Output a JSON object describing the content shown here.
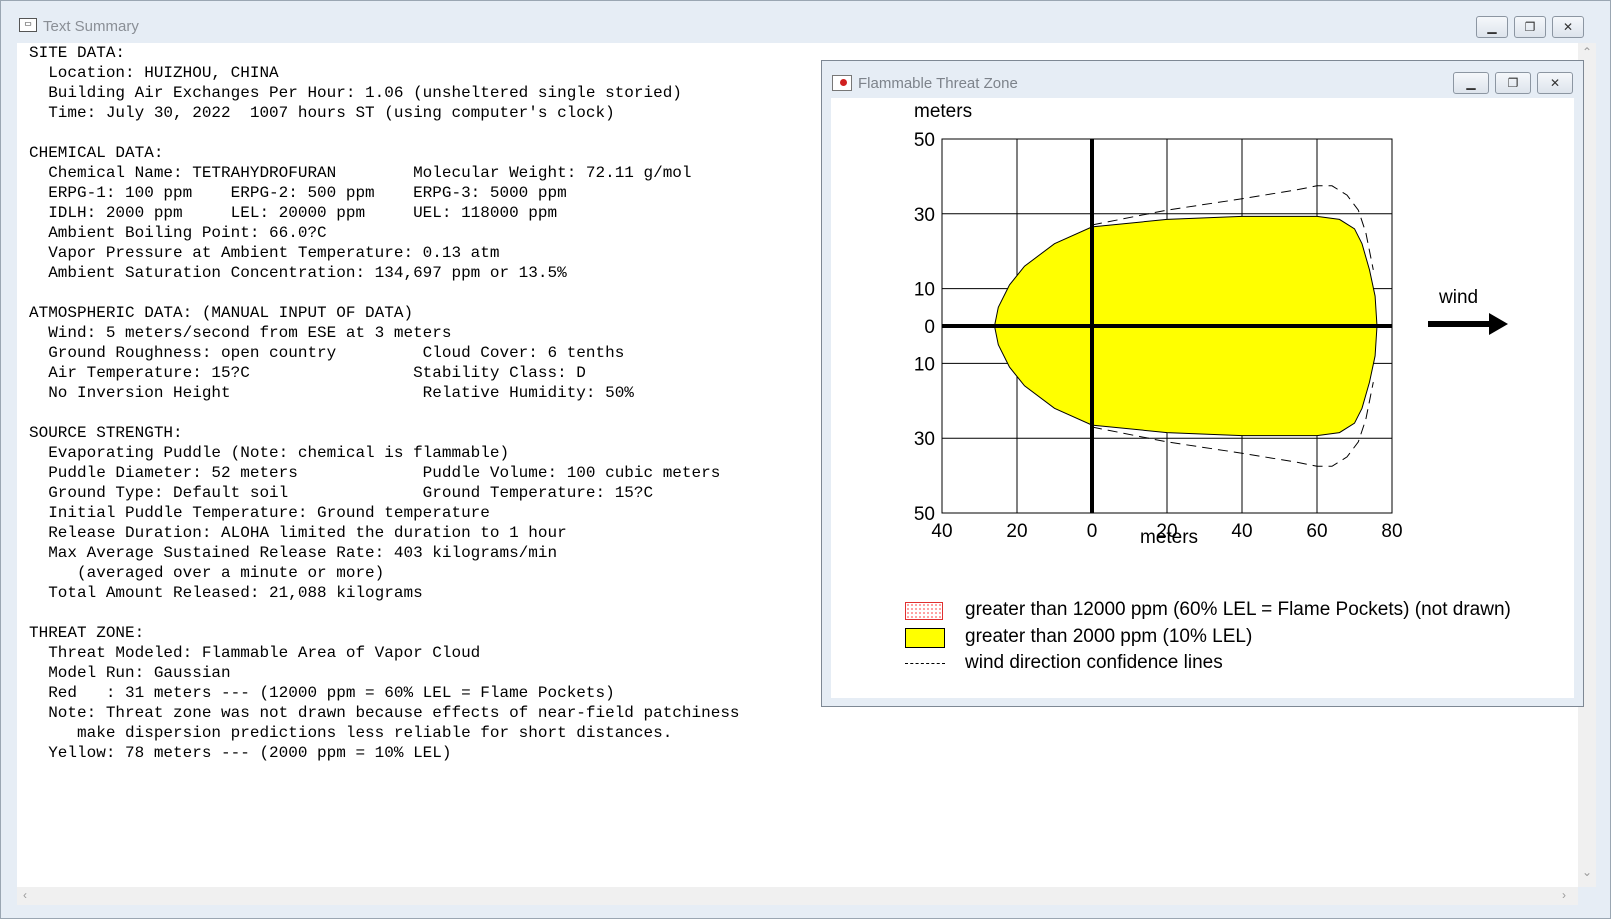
{
  "window": {
    "title": "Text Summary",
    "icon": "app-icon",
    "buttons": {
      "minimize": "minimize-icon",
      "maximize": "maximize-icon",
      "close": "close-icon"
    }
  },
  "summary_lines": [
    "SITE DATA:",
    "  Location: HUIZHOU, CHINA",
    "  Building Air Exchanges Per Hour: 1.06 (unsheltered single storied)",
    "  Time: July 30, 2022  1007 hours ST (using computer's clock)",
    "",
    "CHEMICAL DATA:",
    "  Chemical Name: TETRAHYDROFURAN        Molecular Weight: 72.11 g/mol",
    "  ERPG-1: 100 ppm    ERPG-2: 500 ppm    ERPG-3: 5000 ppm",
    "  IDLH: 2000 ppm     LEL: 20000 ppm     UEL: 118000 ppm",
    "  Ambient Boiling Point: 66.0?C",
    "  Vapor Pressure at Ambient Temperature: 0.13 atm",
    "  Ambient Saturation Concentration: 134,697 ppm or 13.5%",
    "",
    "ATMOSPHERIC DATA: (MANUAL INPUT OF DATA)",
    "  Wind: 5 meters/second from ESE at 3 meters",
    "  Ground Roughness: open country         Cloud Cover: 6 tenths",
    "  Air Temperature: 15?C                 Stability Class: D",
    "  No Inversion Height                    Relative Humidity: 50%",
    "",
    "SOURCE STRENGTH:",
    "  Evaporating Puddle (Note: chemical is flammable)",
    "  Puddle Diameter: 52 meters             Puddle Volume: 100 cubic meters",
    "  Ground Type: Default soil              Ground Temperature: 15?C",
    "  Initial Puddle Temperature: Ground temperature",
    "  Release Duration: ALOHA limited the duration to 1 hour",
    "  Max Average Sustained Release Rate: 403 kilograms/min",
    "     (averaged over a minute or more)",
    "  Total Amount Released: 21,088 kilograms",
    "",
    "THREAT ZONE:",
    "  Threat Modeled: Flammable Area of Vapor Cloud",
    "  Model Run: Gaussian",
    "  Red   : 31 meters --- (12000 ppm = 60% LEL = Flame Pockets)",
    "  Note: Threat zone was not drawn because effects of near-field patchiness",
    "     make dispersion predictions less reliable for short distances.",
    "  Yellow: 78 meters --- (2000 ppm = 10% LEL)"
  ],
  "threat_window": {
    "title": "Flammable Threat Zone",
    "icon": "chart-icon",
    "buttons": {
      "minimize": "minimize-icon",
      "maximize": "maximize-icon",
      "close": "close-icon"
    },
    "wind_label": "wind",
    "legend": [
      {
        "swatch": "red-dotted",
        "label": "greater than 12000 ppm (60% LEL = Flame Pockets) (not drawn)"
      },
      {
        "swatch": "yellow",
        "label": "greater than 2000 ppm (10% LEL)"
      },
      {
        "swatch": "dashed-line",
        "label": "wind direction confidence lines"
      }
    ]
  },
  "chart_data": {
    "type": "area",
    "xlabel": "meters",
    "ylabel": "meters",
    "xlim": [
      -40,
      80
    ],
    "ylim": [
      -50,
      50
    ],
    "x_ticks": [
      -40,
      -20,
      0,
      20,
      40,
      60,
      80
    ],
    "x_tick_labels": [
      "40",
      "20",
      "0",
      "20",
      "40",
      "60",
      "80"
    ],
    "y_ticks": [
      50,
      30,
      10,
      0,
      -10,
      -30,
      -50
    ],
    "y_tick_labels": [
      "50",
      "30",
      "10",
      "0",
      "10",
      "30",
      "50"
    ],
    "grid": true,
    "colors": {
      "zone": "#ffff00",
      "axes": "#000000"
    },
    "yellow_zone": {
      "x": [
        0,
        20,
        40,
        60,
        66,
        70,
        72,
        74,
        75.5,
        76,
        75.5,
        74,
        72,
        70,
        66,
        60,
        40,
        20,
        0,
        -10,
        -18,
        -22,
        -25,
        -26,
        -25,
        -22,
        -18,
        -10,
        0
      ],
      "y": [
        26.5,
        28.5,
        29.3,
        29.3,
        28.5,
        26,
        22,
        15,
        8,
        0,
        -8,
        -15,
        -22,
        -26,
        -28.5,
        -29.3,
        -29.3,
        -28.5,
        -26.5,
        -22,
        -16,
        -11,
        -5,
        0,
        5,
        11,
        16,
        22,
        26.5
      ]
    },
    "confidence_lines": [
      {
        "x": [
          0,
          20,
          40,
          55,
          60,
          64,
          68,
          71,
          73,
          75
        ],
        "y": [
          27,
          31,
          34,
          36.5,
          37.5,
          37.5,
          35,
          31,
          25,
          15
        ]
      },
      {
        "x": [
          0,
          20,
          40,
          55,
          60,
          64,
          68,
          71,
          73,
          75
        ],
        "y": [
          -27,
          -31,
          -34,
          -36.5,
          -37.5,
          -37.5,
          -35,
          -31,
          -25,
          -15
        ]
      }
    ]
  }
}
